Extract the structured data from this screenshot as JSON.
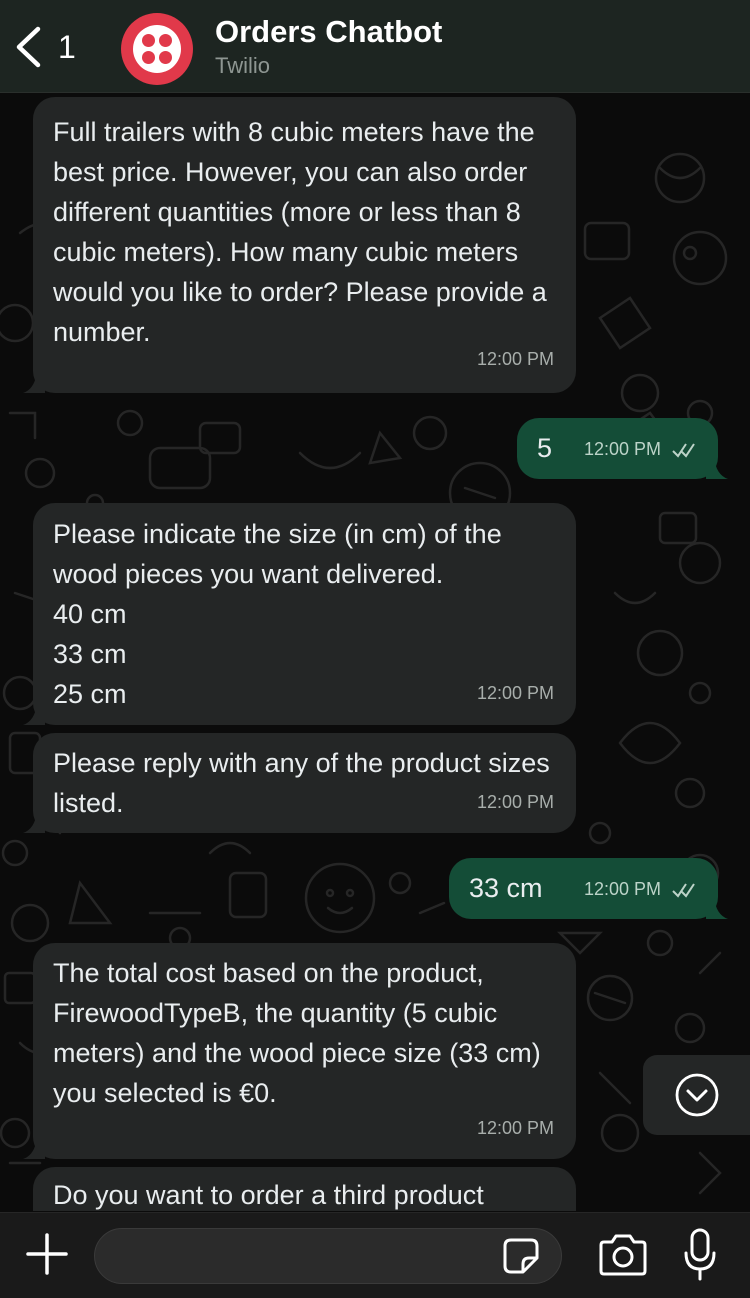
{
  "header": {
    "back_count": "1",
    "title": "Orders Chatbot",
    "subtitle": "Twilio",
    "avatar_color": "#e1394a"
  },
  "messages": [
    {
      "direction": "in",
      "text": "Full trailers with 8 cubic meters have the best price. However, you can also order different quantities (more or less than 8 cubic meters). How many cubic meters would you like to order? Please provide a number.",
      "time": "12:00 PM"
    },
    {
      "direction": "out",
      "text": "5",
      "time": "12:00 PM",
      "status": "read"
    },
    {
      "direction": "in",
      "text": "Please indicate the size (in cm) of the wood pieces you want delivered.\n40 cm\n33 cm\n25 cm",
      "time": "12:00 PM"
    },
    {
      "direction": "in",
      "text": "Please reply with any of the product sizes listed.",
      "time": "12:00 PM"
    },
    {
      "direction": "out",
      "text": "33 cm",
      "time": "12:00 PM",
      "status": "read"
    },
    {
      "direction": "in",
      "text": "The total cost based on the product, FirewoodTypeB, the quantity (5 cubic meters) and the wood piece size (33 cm) you selected is €0.",
      "time": "12:00 PM"
    },
    {
      "direction": "in",
      "text": "Do you want to order a third product",
      "time": ""
    }
  ],
  "composer": {
    "value": "",
    "placeholder": ""
  },
  "icons": {
    "back": "chevron-left-icon",
    "scroll": "chevron-down-circle-icon",
    "plus": "plus-icon",
    "sticker": "sticker-icon",
    "camera": "camera-icon",
    "mic": "microphone-icon"
  },
  "colors": {
    "incoming_bubble": "#242626",
    "outgoing_bubble": "#144d37",
    "background": "#0b0b0b"
  }
}
